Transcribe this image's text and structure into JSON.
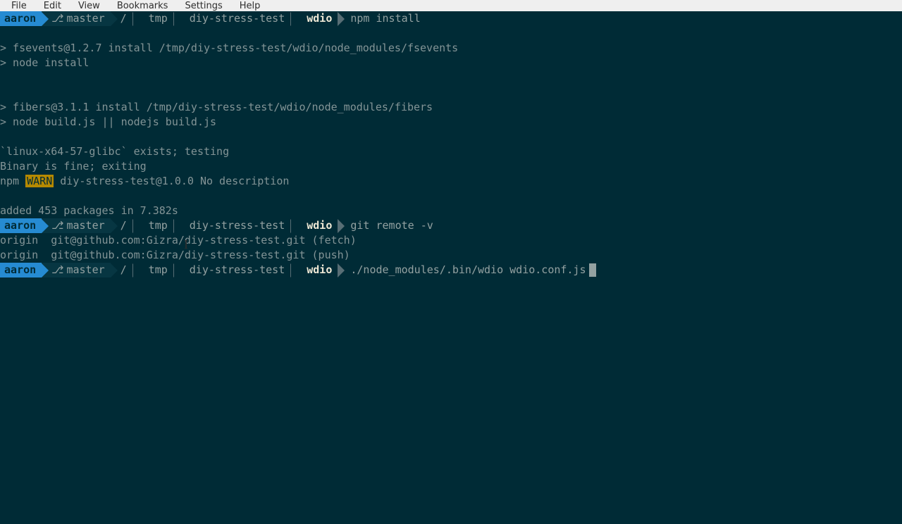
{
  "menubar": {
    "items": [
      "File",
      "Edit",
      "View",
      "Bookmarks",
      "Settings",
      "Help"
    ]
  },
  "prompt": {
    "user": "aaron",
    "branch": "master",
    "path": [
      "/",
      "tmp",
      "diy-stress-test",
      "wdio"
    ]
  },
  "commands": {
    "cmd1": "npm install",
    "cmd2": "git remote -v",
    "cmd3": "./node_modules/.bin/wdio wdio.conf.js"
  },
  "output": {
    "l1": "> fsevents@1.2.7 install /tmp/diy-stress-test/wdio/node_modules/fsevents",
    "l2": "> node install",
    "l3": "> fibers@3.1.1 install /tmp/diy-stress-test/wdio/node_modules/fibers",
    "l4": "> node build.js || nodejs build.js",
    "l5": "`linux-x64-57-glibc` exists; testing",
    "l6": "Binary is fine; exiting",
    "npm_label": "npm",
    "warn_label": "WARN",
    "l7_rest": " diy-stress-test@1.0.0 No description",
    "l8": "added 453 packages in 7.382s",
    "remote1": "origin  git@github.com:Gizra/diy-stress-test.git (fetch)",
    "remote2": "origin  git@github.com:Gizra/diy-stress-test.git (push)"
  }
}
